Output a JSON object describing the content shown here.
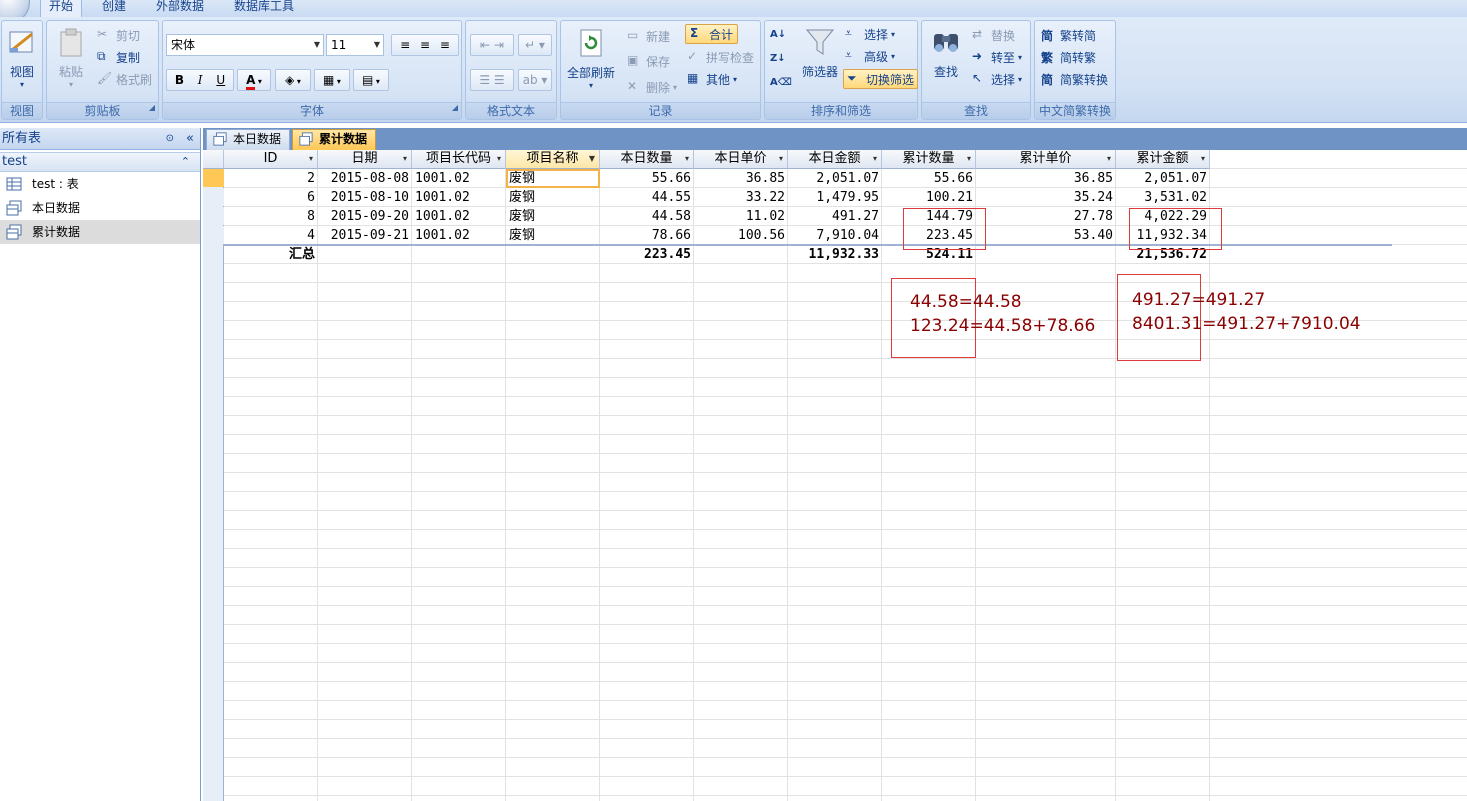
{
  "ribbon_tabs": [
    "开始",
    "创建",
    "外部数据",
    "数据库工具"
  ],
  "groups": {
    "view": {
      "label": "视图",
      "button": "视图"
    },
    "clipboard": {
      "label": "剪贴板",
      "paste": "粘贴",
      "cut": "剪切",
      "copy": "复制",
      "format_painter": "格式刷"
    },
    "font": {
      "label": "字体",
      "font_name": "宋体",
      "font_size": "11",
      "bold": "B",
      "italic": "I",
      "underline": "U",
      "font_color": "A"
    },
    "rich_text": {
      "label": "格式文本"
    },
    "records": {
      "label": "记录",
      "refresh_all": "全部刷新",
      "new": "新建",
      "save": "保存",
      "delete": "删除",
      "totals": "合计",
      "spelling": "拼写检查",
      "more": "其他"
    },
    "sort_filter": {
      "label": "排序和筛选",
      "filter": "筛选器",
      "selection": "选择",
      "advanced": "高级",
      "toggle_filter": "切换筛选"
    },
    "find": {
      "label": "查找",
      "find": "查找",
      "replace": "替换",
      "goto": "转至",
      "select": "选择"
    },
    "chinese": {
      "label": "中文简繁转换",
      "to_simplified": "繁转简",
      "to_traditional": "简转繁",
      "convert": "简繁转换"
    }
  },
  "nav": {
    "header": "所有表",
    "group": "test",
    "items": [
      {
        "label": "test : 表"
      },
      {
        "label": "本日数据"
      },
      {
        "label": "累计数据"
      }
    ]
  },
  "doc_tabs": [
    "本日数据",
    "累计数据"
  ],
  "table": {
    "columns": [
      "ID",
      "日期",
      "项目长代码",
      "项目名称",
      "本日数量",
      "本日单价",
      "本日金额",
      "累计数量",
      "累计单价",
      "累计金额"
    ],
    "rows": [
      [
        "2",
        "2015-08-08",
        "1001.02",
        "废钢",
        "55.66",
        "36.85",
        "2,051.07",
        "55.66",
        "36.85",
        "2,051.07"
      ],
      [
        "6",
        "2015-08-10",
        "1001.02",
        "废钢",
        "44.55",
        "33.22",
        "1,479.95",
        "100.21",
        "35.24",
        "3,531.02"
      ],
      [
        "8",
        "2015-09-20",
        "1001.02",
        "废钢",
        "44.58",
        "11.02",
        "491.27",
        "144.79",
        "27.78",
        "4,022.29"
      ],
      [
        "4",
        "2015-09-21",
        "1001.02",
        "废钢",
        "78.66",
        "100.56",
        "7,910.04",
        "223.45",
        "53.40",
        "11,932.34"
      ]
    ],
    "totals": [
      "汇总",
      "",
      "",
      "",
      "223.45",
      "",
      "11,932.33",
      "524.11",
      "",
      "21,536.72"
    ]
  },
  "annotations": {
    "qty_line1": "44.58=44.58",
    "qty_line2": "123.24=44.58+78.66",
    "amt_line1": "491.27=491.27",
    "amt_line2": "8401.31=491.27+7910.04"
  },
  "colors": {
    "accent": "#15428b",
    "highlight": "#ffc755",
    "annotation": "#8b0000",
    "box": "#e0393b"
  }
}
